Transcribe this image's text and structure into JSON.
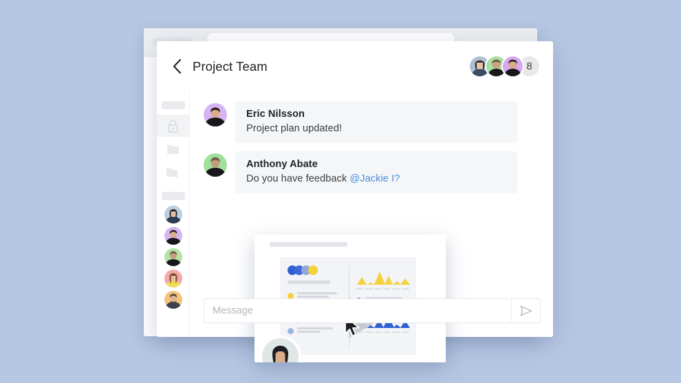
{
  "theme": {
    "background": "#b6c7e3",
    "window_bg": "#ffffff",
    "bubble_bg": "#f5f6f8",
    "mention_color": "#4a8cd8",
    "accent_blue": "#2f5fd0",
    "accent_yellow": "#f5d13b"
  },
  "background_window": {
    "name": "background-app-window",
    "topbar_chip": "",
    "search_pill_placeholder": ""
  },
  "chat": {
    "header": {
      "back_icon": "chevron-left-icon",
      "title": "Project Team",
      "participants": [
        {
          "name": "participant-1",
          "color": "#aebfd4"
        },
        {
          "name": "participant-2",
          "color": "#a7e0a0"
        },
        {
          "name": "participant-3",
          "color": "#d6a8f0"
        }
      ],
      "overflow_count": "8"
    },
    "sidebar": {
      "items": [
        {
          "name": "sidebar-chip-top",
          "type": "chip"
        },
        {
          "name": "sidebar-item-private-channel",
          "type": "icon",
          "icon": "lock-icon",
          "active": true
        },
        {
          "name": "sidebar-item-folder",
          "type": "icon",
          "icon": "folder-icon",
          "active": false
        },
        {
          "name": "sidebar-item-new-folder",
          "type": "icon",
          "icon": "folder-plus-icon",
          "active": false
        },
        {
          "name": "sidebar-chip-section",
          "type": "chip"
        }
      ],
      "avatars": [
        {
          "name": "sidebar-avatar-1",
          "color": "#b9cfe0"
        },
        {
          "name": "sidebar-avatar-2",
          "color": "#d6b4f2"
        },
        {
          "name": "sidebar-avatar-3",
          "color": "#b3e3a5"
        },
        {
          "name": "sidebar-avatar-4",
          "color": "#f3a9a9"
        },
        {
          "name": "sidebar-avatar-5",
          "color": "#f5c27a"
        }
      ]
    },
    "messages": [
      {
        "author": "Eric Nilsson",
        "text": "Project plan updated!",
        "avatar_color": "#d6b4f2",
        "mention": ""
      },
      {
        "author": "Anthony Abate",
        "text": "Do you have feedback ",
        "avatar_color": "#9fe09a",
        "mention": "@Jackie I?"
      }
    ],
    "composer": {
      "placeholder": "Message",
      "value": "",
      "send_icon": "send-arrow-icon"
    }
  },
  "share_card": {
    "name": "screen-share-card",
    "title_placeholder": "",
    "play_icon": "play-triangle-icon",
    "cursor_icon": "mouse-cursor-icon",
    "camera_thumbnail": "presenter-video-thumbnail",
    "slide": {
      "header_dots": [
        "#2f5fd0",
        "#3d6cd8",
        "#8fa9dd",
        "#f5d13b"
      ],
      "legend": [
        {
          "color": "#f5d13b",
          "lines": 2
        },
        {
          "color": "#2f5fd0",
          "lines": 2
        },
        {
          "color": "#4f7ddc",
          "lines": 1
        },
        {
          "color": "#9bb4e4",
          "lines": 2
        }
      ],
      "note_dot": "#2f5fd0"
    }
  },
  "chart_data": [
    {
      "type": "area",
      "name": "top-yellow-peaks-chart",
      "categories": [
        "1",
        "2",
        "3",
        "4",
        "5",
        "6"
      ],
      "values": [
        11,
        3,
        19,
        13,
        5,
        9
      ],
      "color": "#f5d13b",
      "title": "",
      "xlabel": "",
      "ylabel": "",
      "ylim": [
        0,
        20
      ],
      "grid": false,
      "legend": "none"
    },
    {
      "type": "area",
      "name": "bottom-blue-peaks-chart",
      "categories": [
        "1",
        "2",
        "3",
        "4",
        "5",
        "6"
      ],
      "values": [
        10,
        4,
        13,
        17,
        5,
        11
      ],
      "color": "#2f5fd0",
      "title": "",
      "xlabel": "",
      "ylabel": "",
      "ylim": [
        0,
        20
      ],
      "grid": false,
      "legend": "none"
    }
  ]
}
